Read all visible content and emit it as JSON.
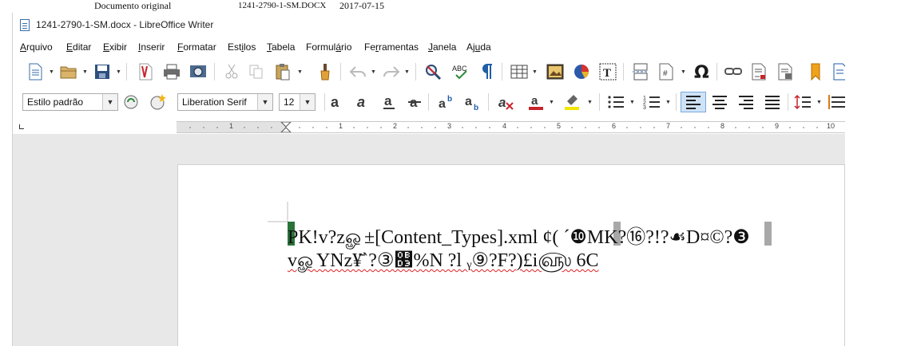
{
  "caption": {
    "title": "Documento original",
    "filename": "1241-2790-1-SM.DOCX",
    "date": "2017-07-15"
  },
  "window": {
    "title": "1241-2790-1-SM.docx - LibreOffice Writer"
  },
  "menu": [
    {
      "k": "A",
      "rest": "rquivo"
    },
    {
      "k": "E",
      "rest": "ditar"
    },
    {
      "k": "E",
      "rest": "xibir"
    },
    {
      "k": "I",
      "rest": "nserir"
    },
    {
      "k": "F",
      "rest": "ormatar"
    },
    {
      "pre": "Est",
      "k": "i",
      "rest": "los"
    },
    {
      "k": "T",
      "rest": "abela"
    },
    {
      "pre": "Formul",
      "k": "á",
      "rest": "rio"
    },
    {
      "pre": "Fe",
      "k": "r",
      "rest": "ramentas"
    },
    {
      "k": "J",
      "rest": "anela"
    },
    {
      "pre": "Aj",
      "k": "u",
      "rest": "da"
    }
  ],
  "formatting": {
    "paragraph_style": "Estilo padrão",
    "font_name": "Liberation Serif",
    "font_size": "12"
  },
  "ruler": {
    "numbers": [
      "1",
      "1",
      "2",
      "3",
      "4",
      "5",
      "6",
      "7",
      "8",
      "9",
      "10"
    ]
  },
  "document": {
    "line1": "PK!v?zௐ±[Content_Types].xml ¢( ´❿MK?⑯?!?☙D¤©?❸",
    "line2": "vௐYNz¥̄`?③௓%N ?l ᵧ⑨?F?)£i௵ 6C"
  },
  "colors": {
    "accent": "#1d6b2f",
    "selection": "#a8a8a8",
    "spell_underline": "#dd2222",
    "active_button": "#cfe3f7"
  },
  "icons": [
    "new-document-icon",
    "open-folder-icon",
    "save-icon",
    "export-pdf-icon",
    "print-icon",
    "print-preview-icon",
    "cut-icon",
    "copy-icon",
    "paste-icon",
    "clone-formatting-icon",
    "undo-icon",
    "redo-icon",
    "find-replace-icon",
    "spelling-icon",
    "formatting-marks-icon",
    "insert-table-icon",
    "insert-image-icon",
    "insert-chart-icon",
    "insert-textbox-icon",
    "page-break-icon",
    "field-icon",
    "special-character-icon",
    "hyperlink-icon",
    "footnote-icon",
    "endnote-icon",
    "bookmark-icon",
    "cross-reference-icon"
  ]
}
